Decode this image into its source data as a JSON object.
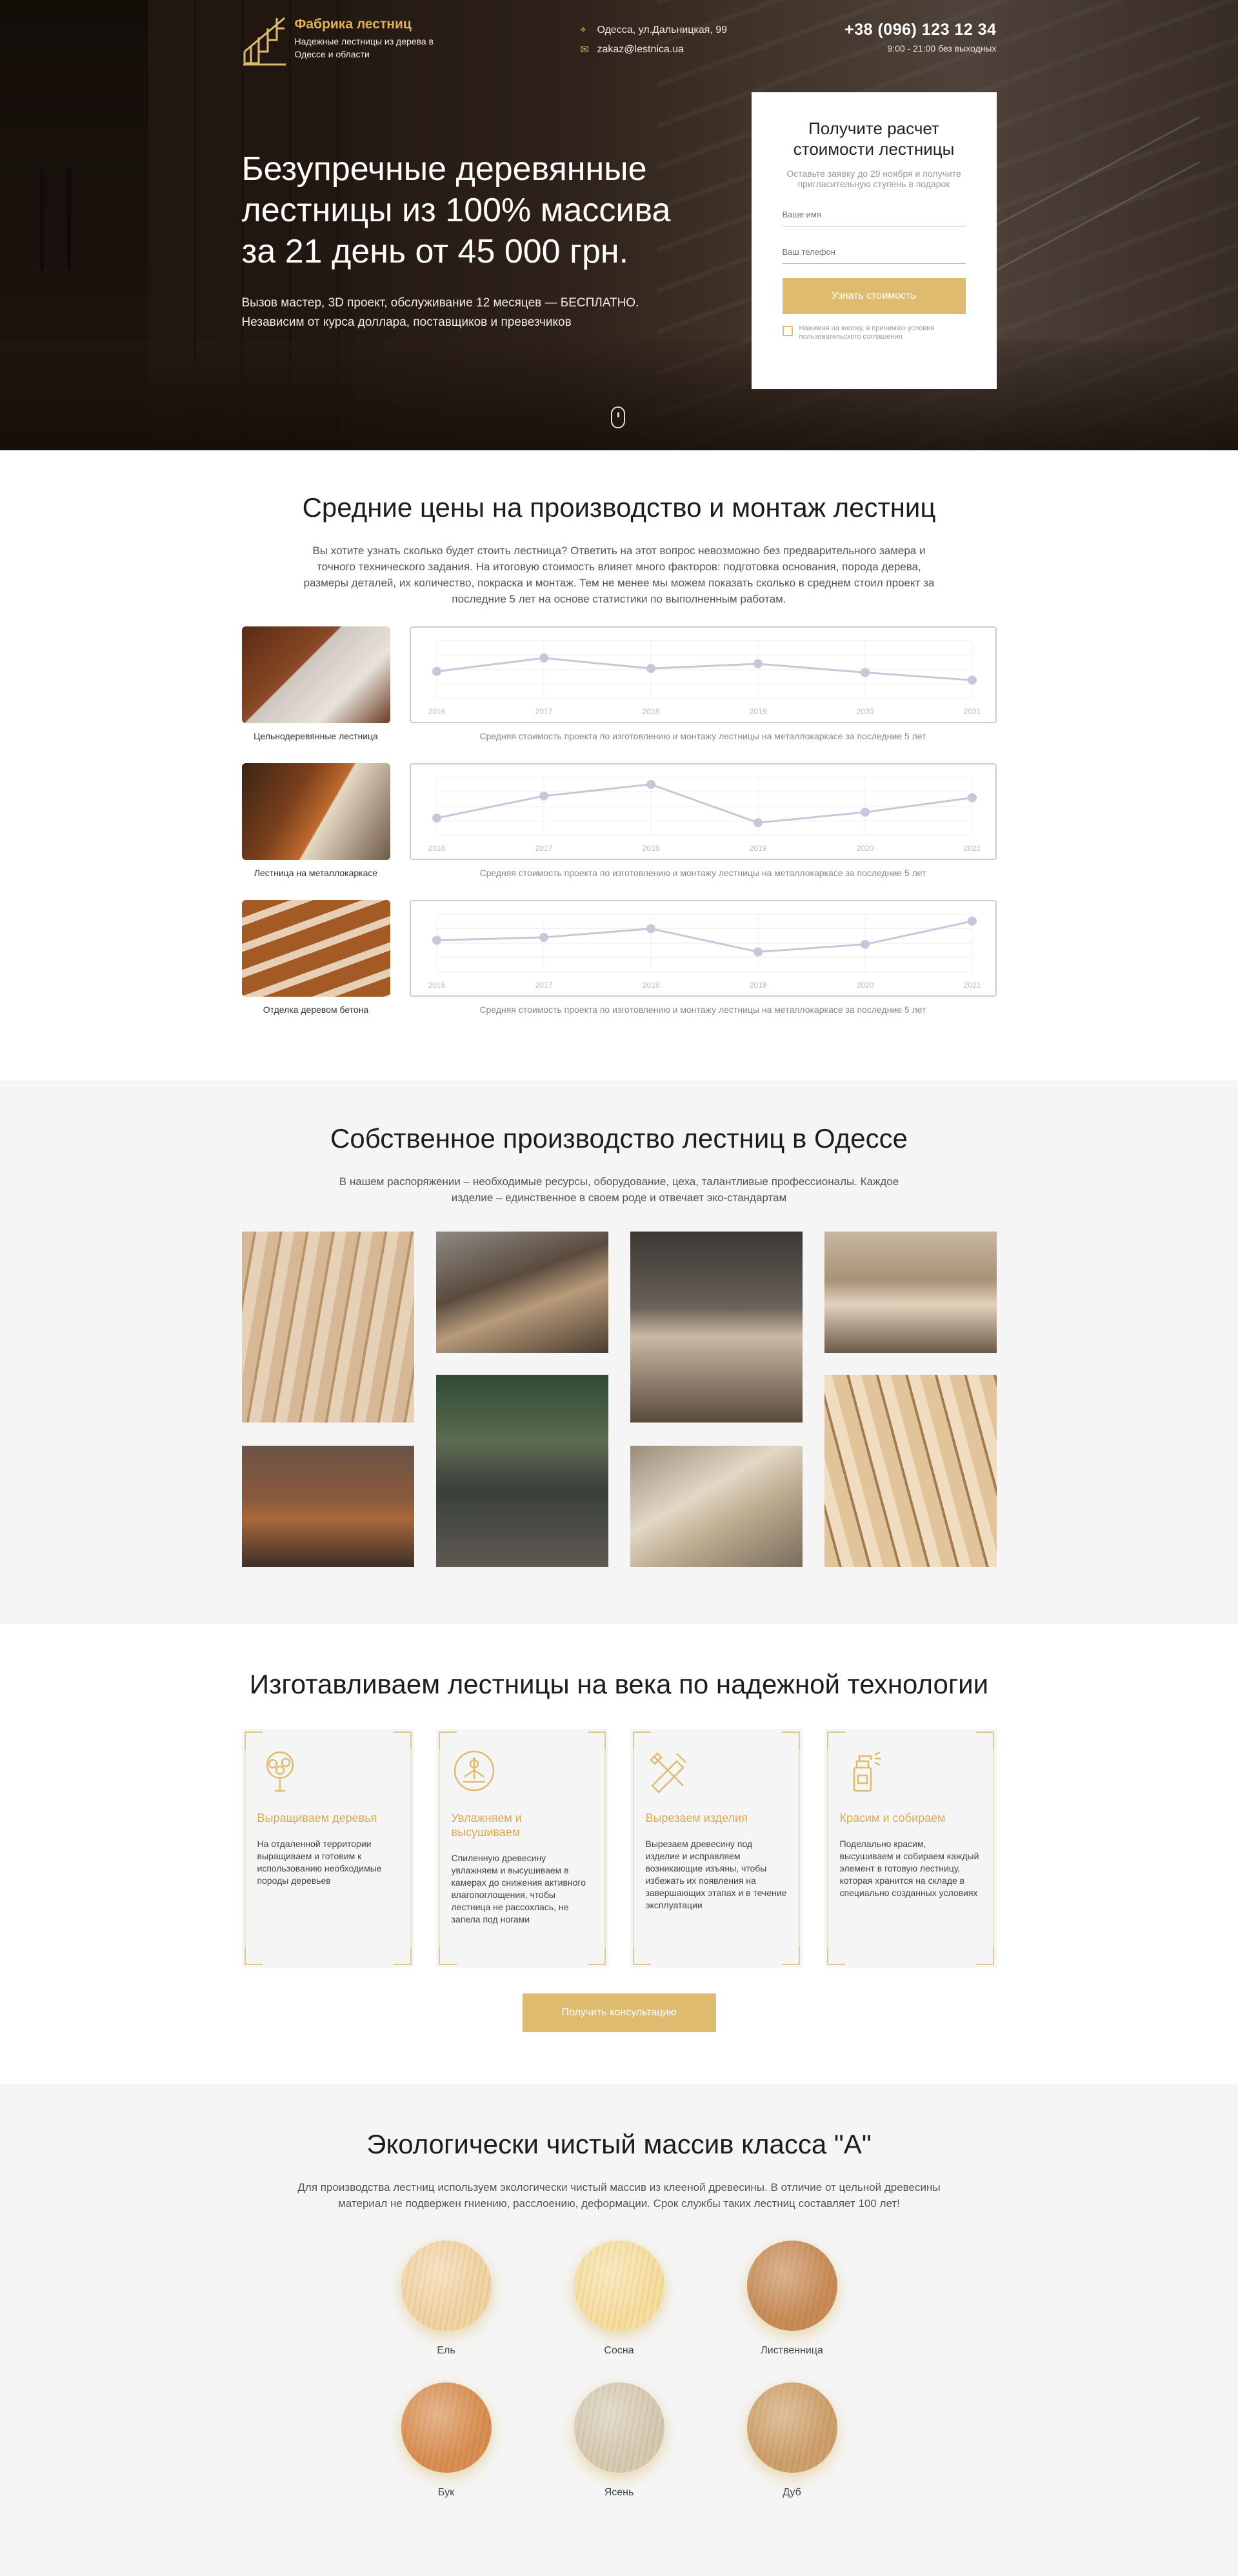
{
  "header": {
    "logo_title": "Фабрика лестниц",
    "logo_subtitle": "Надежные лестницы из дерева в Одессе и области",
    "address": "Одесса, ул.Дальницкая, 99",
    "email": "zakaz@lestnica.ua",
    "phone": "+38 (096) 123 12 34",
    "hours": "9:00 - 21:00 без выходных"
  },
  "hero": {
    "title": "Безупречные деревянные лестницы из 100% массива за 21 день от 45 000 грн.",
    "text": "Вызов мастер, 3D проект, обслуживание 12 месяцев — БЕСПЛАТНО. Независим от курса доллара, поставщиков и превезчиков"
  },
  "form": {
    "title": "Получите расчет стоимости лестницы",
    "note": "Оставьте заявку до 29 ноября и получите пригласительную ступень в подарок",
    "name_placeholder": "Ваше имя",
    "phone_placeholder": "Ваш телефон",
    "submit_label": "Узнать стоимость",
    "agree_text": "Нажимая на кнопку, я принимаю условия пользовательского соглашения"
  },
  "prices": {
    "title": "Средние цены на производство и монтаж лестниц",
    "text": "Вы хотите узнать сколько будет стоить лестница? Ответить на этот вопрос невозможно без предварительного замера и точного технического задания. На итоговую стоимость влияет много факторов: подготовка основания, порода дерева, размеры деталей, их количество, покраска и монтаж. Тем не менее мы можем показать сколько в среднем стоил проект за последние 5 лет на основе статистики по выполненным работам.",
    "rows": [
      {
        "caption": "Цельнодеревянные лестница",
        "chart_caption": "Средняя стоимость проекта по изготовлению и монтажу лестницы на металлокаркасе за последние 5 лет"
      },
      {
        "caption": "Лестница на металлокаркасе",
        "chart_caption": "Средняя стоимость проекта по изготовлению и монтажу лестницы на металлокаркасе за последние 5 лет"
      },
      {
        "caption": "Отделка деревом бетона",
        "chart_caption": "Средняя стоимость проекта по изготовлению и монтажу лестницы на металлокаркасе за последние 5 лет"
      }
    ]
  },
  "chart_data": [
    {
      "type": "line",
      "x": [
        "2016",
        "2017",
        "2018",
        "2019",
        "2020",
        "2021"
      ],
      "values": [
        47,
        70,
        52,
        60,
        45,
        32
      ],
      "ylim": [
        0,
        100
      ],
      "grid": true
    },
    {
      "type": "line",
      "x": [
        "2016",
        "2017",
        "2018",
        "2019",
        "2020",
        "2021"
      ],
      "values": [
        30,
        68,
        88,
        22,
        40,
        65
      ],
      "ylim": [
        0,
        100
      ],
      "grid": true
    },
    {
      "type": "line",
      "x": [
        "2016",
        "2017",
        "2018",
        "2019",
        "2020",
        "2021"
      ],
      "values": [
        55,
        60,
        75,
        35,
        48,
        88
      ],
      "ylim": [
        0,
        100
      ],
      "grid": true
    }
  ],
  "production": {
    "title": "Собственное производство лестниц в Одессе",
    "text": "В нашем распоряжении – необходимые ресурсы, оборудование, цеха, талантливые профессионалы. Каждое изделие – единственное в своем роде и отвечает эко-стандартам"
  },
  "tech": {
    "title": "Изготавливаем лестницы на века по надежной технологии",
    "cards": [
      {
        "title": "Выращиваем деревья",
        "text": "На отдаленной территории выращиваем и готовим к использованию необходимые породы деревьев"
      },
      {
        "title": "Увлажняем и высушиваем",
        "text": "Спиленную древесину увлажняем и высушиваем в камерах до снижения активного влагопоглощения, чтобы лестница не рассохлась, не запела под ногами"
      },
      {
        "title": "Вырезаем изделия",
        "text": "Вырезаем древесину под изделие и исправляем возникающие изъяны, чтобы избежать их появления на завершающих этапах и в течение эксплуатации"
      },
      {
        "title": "Красим и собираем",
        "text": "Поделально красим, высушиваем и собираем каждый элемент в готовую лестницу, которая хранится на складе в специально созданных условиях"
      }
    ],
    "cta_label": "Получить консультацию"
  },
  "eco": {
    "title": "Экологически чистый массив класса \"А\"",
    "text": "Для производства лестниц используем экологически чистый массив из клееной древесины. В отличие от цельной древесины материал не подвержен гниению, расслоению, деформации. Срок службы таких лестниц составляет 100 лет!",
    "woods": [
      {
        "name": "Ель",
        "color": "#f2d3a2"
      },
      {
        "name": "Сосна",
        "color": "#f7de9f"
      },
      {
        "name": "Лиственница",
        "color": "#c98c57"
      },
      {
        "name": "Бук",
        "color": "#d98f51"
      },
      {
        "name": "Ясень",
        "color": "#d6cab1"
      },
      {
        "name": "Дуб",
        "color": "#cfa06a"
      }
    ]
  },
  "colors": {
    "accent": "#dfbb70",
    "accent_text": "#d9ab55",
    "section_gray": "#f5f5f5"
  }
}
